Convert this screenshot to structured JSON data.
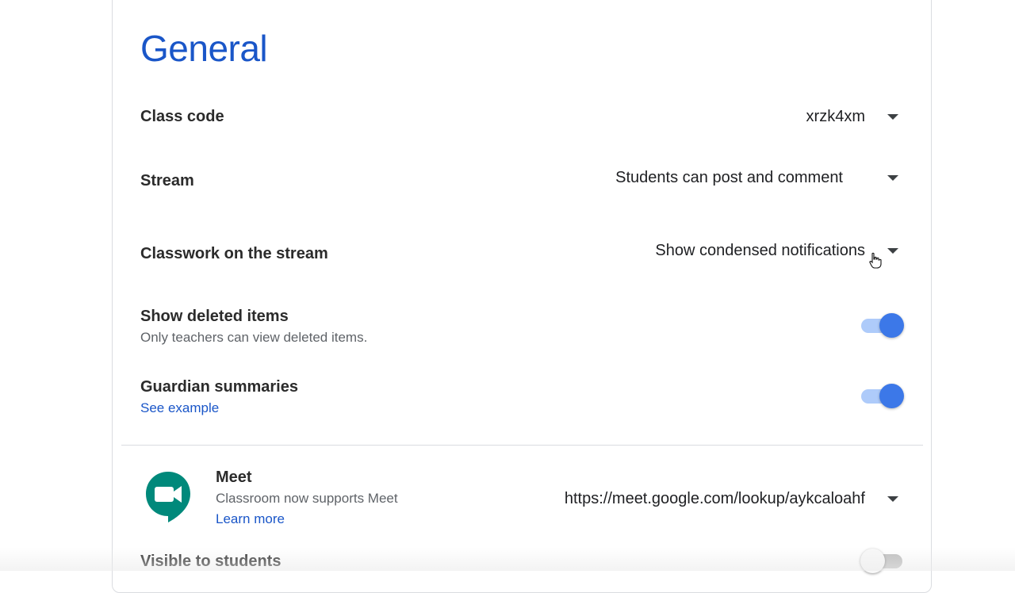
{
  "general": {
    "title": "General",
    "class_code": {
      "label": "Class code",
      "value": "xrzk4xm"
    },
    "stream": {
      "label": "Stream",
      "value": "Students can post and comment"
    },
    "classwork_on_stream": {
      "label": "Classwork on the stream",
      "value": "Show condensed notifications"
    },
    "show_deleted_items": {
      "label": "Show deleted items",
      "description": "Only teachers can view deleted items.",
      "enabled": true
    },
    "guardian_summaries": {
      "label": "Guardian summaries",
      "link": "See example",
      "enabled": true
    },
    "meet": {
      "label": "Meet",
      "description": "Classroom now supports Meet",
      "link": "Learn more",
      "value": "https://meet.google.com/lookup/aykcaloahf",
      "icon": "google-meet-icon"
    },
    "visible_to_students": {
      "label": "Visible to students",
      "enabled": false
    }
  },
  "colors": {
    "accent": "#1a56c8",
    "toggle_on": "#3c78e8",
    "meet_green": "#00897b"
  }
}
